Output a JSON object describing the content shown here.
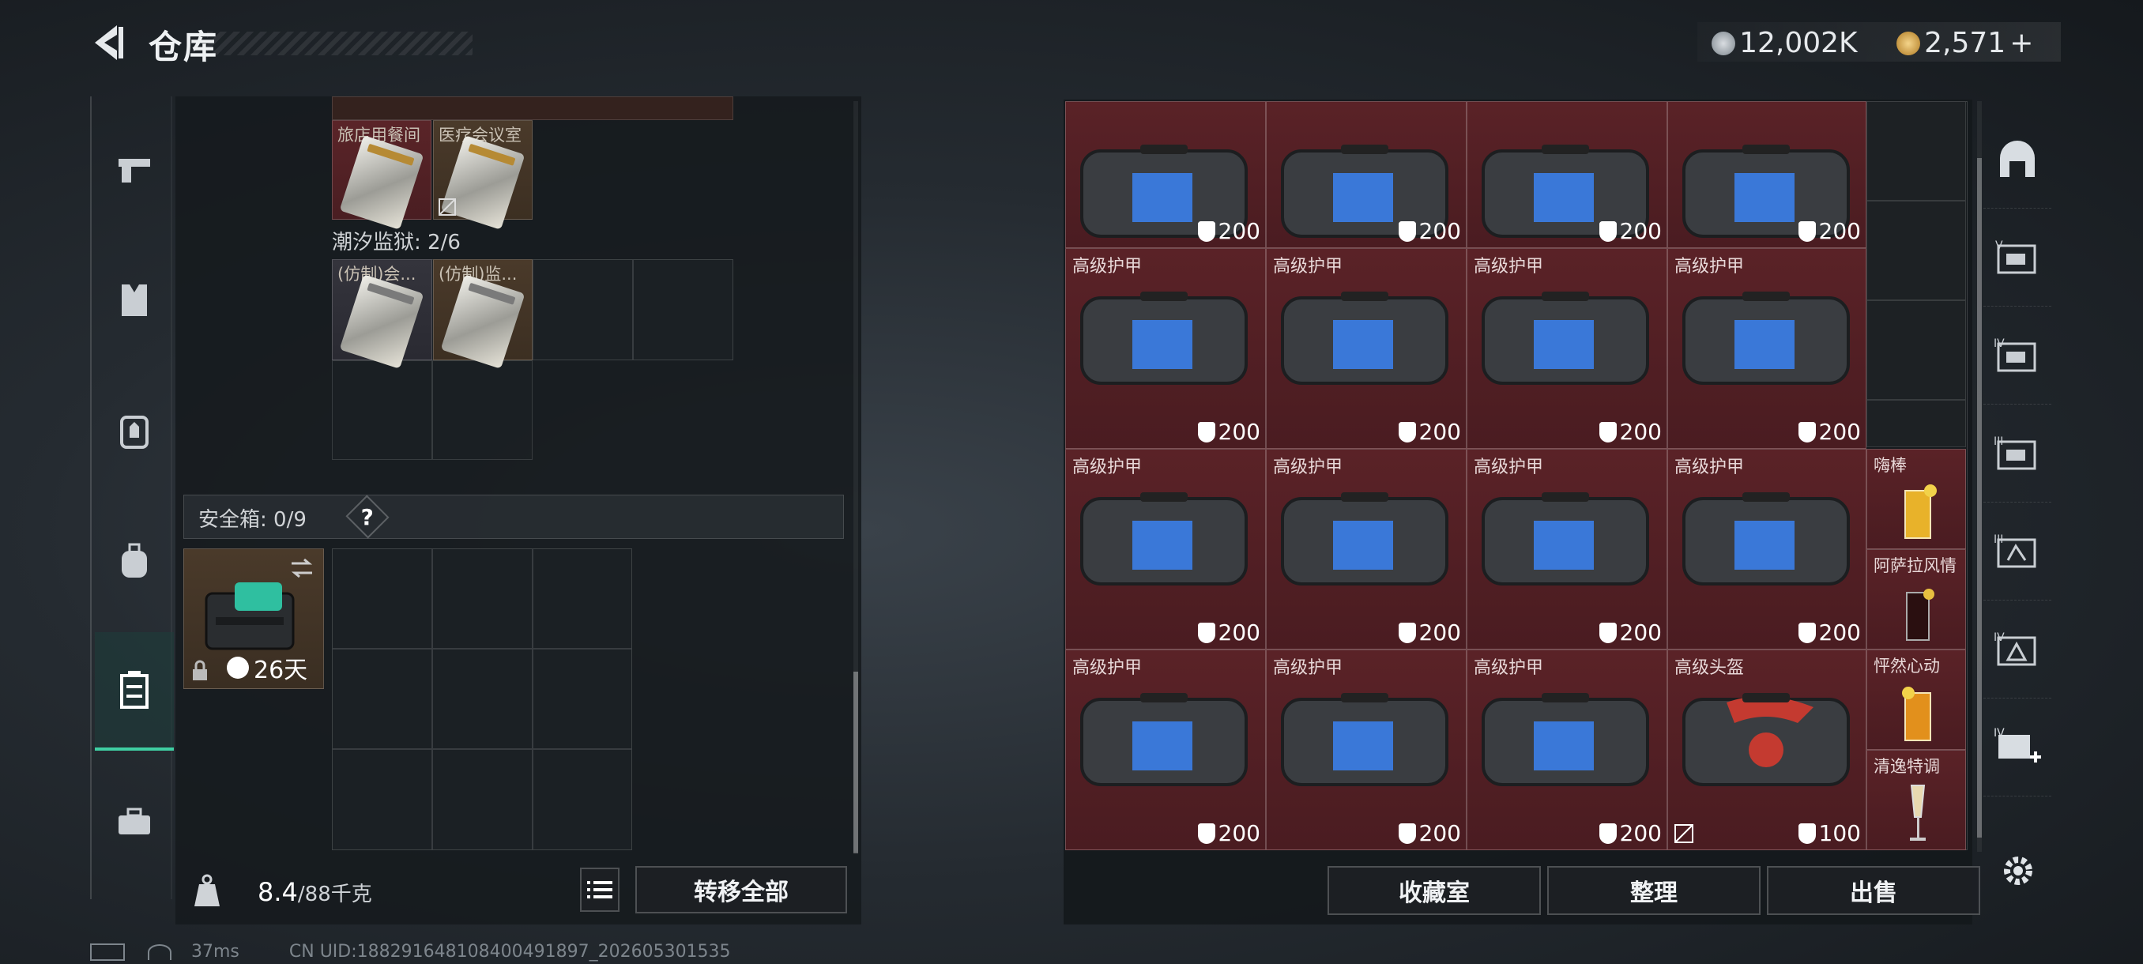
{
  "header": {
    "title": "仓库",
    "currency1": "12,002K",
    "currency2": "2,571",
    "add_symbol": "+",
    "colors": {
      "coin1": "#9aa3ab",
      "coin2": "#d6a54a"
    }
  },
  "left_nav": {
    "items": [
      "pistol-icon",
      "vest-icon",
      "backpack-armor-icon",
      "backpack-icon",
      "container-icon",
      "toolbox-icon"
    ],
    "active_index": 4,
    "accent": "#3fcfa3"
  },
  "inventory": {
    "top_items": [
      {
        "label": "旅店用餐间"
      },
      {
        "label": "医疗会议室"
      }
    ],
    "section_title": "潮汐监狱: 2/6",
    "section_items": [
      {
        "label": "(仿制)会..."
      },
      {
        "label": "(仿制)监..."
      }
    ],
    "safe_box": {
      "label": "安全箱: 0/9",
      "help": "?",
      "item_timer": "26天"
    },
    "weight": {
      "current": "8.4",
      "max": "/88千克"
    },
    "transfer_all": "转移全部"
  },
  "storage": {
    "items": [
      {
        "name": "",
        "durability": "200"
      },
      {
        "name": "",
        "durability": "200"
      },
      {
        "name": "",
        "durability": "200"
      },
      {
        "name": "",
        "durability": "200"
      },
      {
        "name": "高级护甲",
        "durability": "200"
      },
      {
        "name": "高级护甲",
        "durability": "200"
      },
      {
        "name": "高级护甲",
        "durability": "200"
      },
      {
        "name": "高级护甲",
        "durability": "200"
      },
      {
        "name": "高级护甲",
        "durability": "200"
      },
      {
        "name": "高级护甲",
        "durability": "200"
      },
      {
        "name": "高级护甲",
        "durability": "200"
      },
      {
        "name": "高级护甲",
        "durability": "200"
      },
      {
        "name": "高级护甲",
        "durability": "200"
      },
      {
        "name": "高级护甲",
        "durability": "200"
      },
      {
        "name": "高级护甲",
        "durability": "200"
      },
      {
        "name": "高级头盔",
        "durability": "100"
      }
    ],
    "drinks": [
      "嗨棒",
      "阿萨拉风情",
      "怦然心动",
      "清逸特调"
    ],
    "buttons": {
      "collection": "收藏室",
      "organize": "整理",
      "sell": "出售"
    }
  },
  "right_nav": {
    "items": [
      "dome-icon",
      "v-case-icon",
      "iv-case-icon",
      "iii-case-icon",
      "iii-case-2-icon",
      "iv-box-icon",
      "iv-add-icon",
      "settings-icon"
    ]
  },
  "status": {
    "ping": "37ms",
    "uid": "CN UID:188291648108400491897_202605301535"
  }
}
